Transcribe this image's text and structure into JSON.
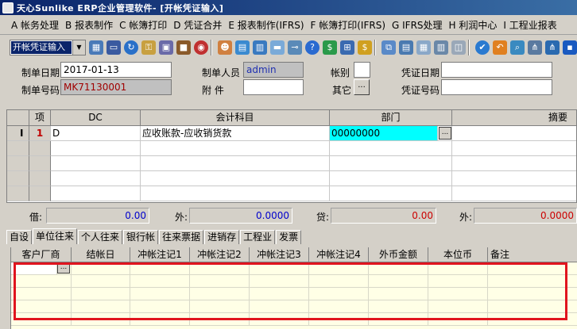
{
  "window": {
    "title": "天心Sunlike ERP企业管理软件- [开帐凭证输入]"
  },
  "menu": [
    "A 帐务处理",
    "B 报表制作",
    "C 帐簿打印",
    "D 凭证合并",
    "E 报表制作(IFRS)",
    "F 帐簿打印(IFRS)",
    "G IFRS处理",
    "H 利润中心",
    "I 工程业报表"
  ],
  "toolbar": {
    "selected_function": "开帐凭证输入"
  },
  "header": {
    "date_label": "制单日期",
    "date_value": "2017-01-13",
    "number_label": "制单号码",
    "number_value": "MK71130001",
    "user_label": "制单人员",
    "user_value": "admin",
    "attach_label": "附    件",
    "attach_value": "",
    "book_label": "帐别",
    "book_value": "",
    "other_label": "其它",
    "other_button": "...",
    "voucher_date_label": "凭证日期",
    "voucher_date_value": "",
    "voucher_no_label": "凭证号码",
    "voucher_no_value": ""
  },
  "voucher_grid": {
    "columns": [
      "项",
      "DC",
      "会计科目",
      "部门",
      "摘要"
    ],
    "rows": [
      {
        "no": "1",
        "dc": "D",
        "account": "应收账款-应收销货款",
        "dept": "00000000",
        "memo": ""
      }
    ]
  },
  "totals": {
    "debit_label": "借:",
    "debit_value": "0.00",
    "debit_fx_label": "外:",
    "debit_fx_value": "0.0000",
    "credit_label": "贷:",
    "credit_value": "0.00",
    "credit_fx_label": "外:",
    "credit_fx_value": "0.0000"
  },
  "tabs": [
    "自设",
    "单位往来",
    "个人往来",
    "银行帐",
    "往来票据",
    "进销存",
    "工程业",
    "发票"
  ],
  "detail_grid": {
    "columns": [
      "客户厂商",
      "结帐日",
      "冲帐注记1",
      "冲帐注记2",
      "冲帐注记3",
      "冲帐注记4",
      "外币金额",
      "本位币",
      "备注"
    ],
    "cell_button": "..."
  },
  "colors": {
    "title_bar": "#0a246a",
    "active_cell": "#00ffff",
    "highlight_box": "#e0141e",
    "row_number": "#c00000",
    "total_value": "#0000cc",
    "total_value_credit": "#cc0000"
  }
}
